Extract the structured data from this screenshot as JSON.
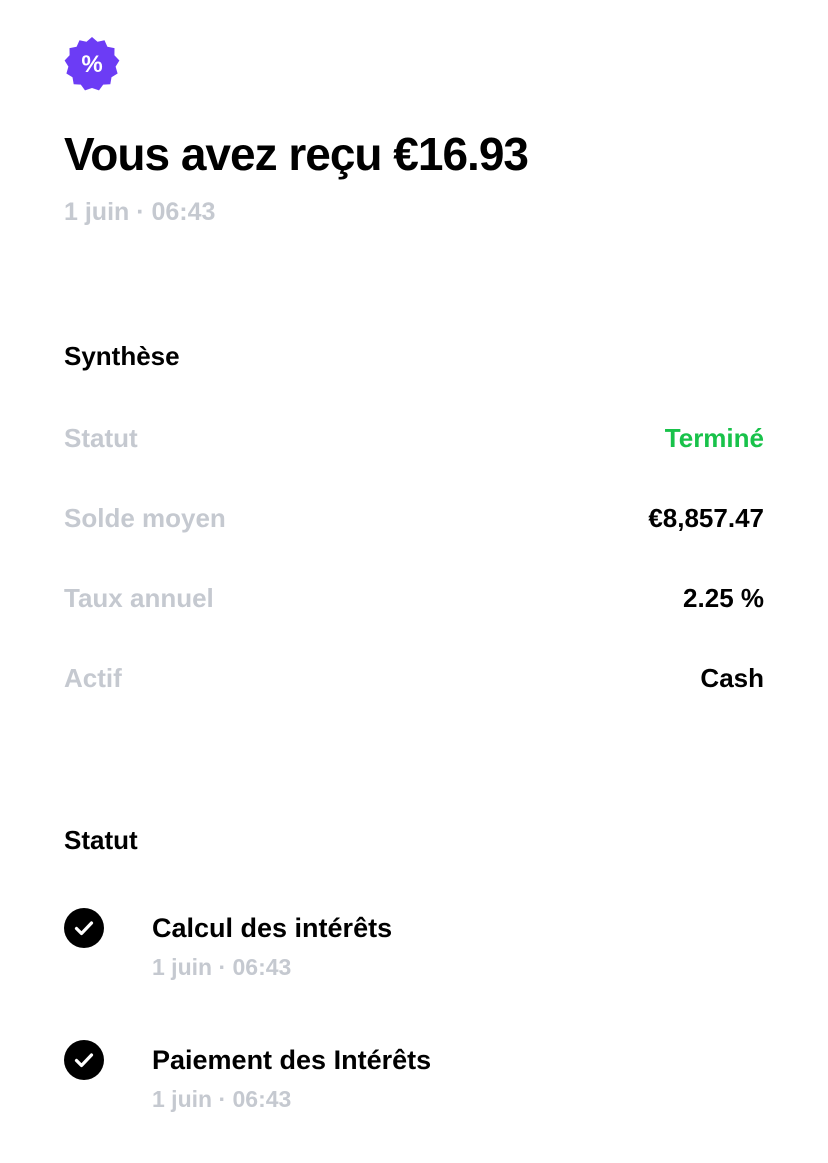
{
  "header": {
    "icon": "percent-badge-icon",
    "icon_symbol": "%",
    "title": "Vous avez reçu €16.93",
    "date": "1 juin · 06:43"
  },
  "summary": {
    "title": "Synthèse",
    "rows": [
      {
        "label": "Statut",
        "value": "Terminé"
      },
      {
        "label": "Solde moyen",
        "value": "€8,857.47"
      },
      {
        "label": "Taux annuel",
        "value": "2.25 %"
      },
      {
        "label": "Actif",
        "value": "Cash"
      }
    ]
  },
  "status": {
    "title": "Statut",
    "steps": [
      {
        "icon": "check-circle-icon",
        "title": "Calcul des intérêts",
        "date": "1 juin · 06:43"
      },
      {
        "icon": "check-circle-icon",
        "title": "Paiement des Intérêts",
        "date": "1 juin · 06:43"
      }
    ]
  },
  "colors": {
    "accent": "#6c3cf5",
    "success": "#18c24a",
    "muted": "#c5c9d0",
    "text": "#000000"
  }
}
